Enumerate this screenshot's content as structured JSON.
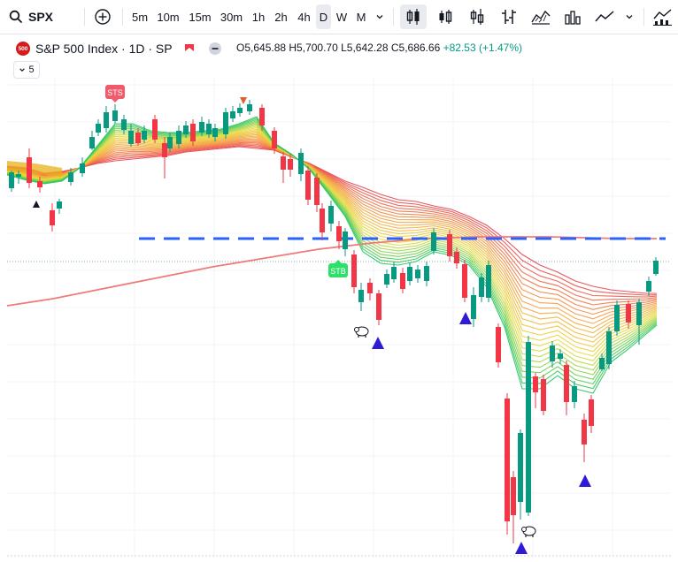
{
  "toolbar": {
    "symbol": "SPX",
    "intervals": [
      "5m",
      "10m",
      "15m",
      "30m",
      "1h",
      "2h",
      "4h",
      "D",
      "W",
      "M"
    ],
    "active_interval": "D"
  },
  "legend": {
    "logo_text": "500",
    "title": "S&P 500 Index · 1D · SP",
    "open": "O5,645.88",
    "high": "H5,700.70",
    "low": "L5,642.28",
    "close": "C5,686.66",
    "change": "+82.53 (+1.47%)"
  },
  "indicators": {
    "count": "5"
  },
  "colors": {
    "up": "#089981",
    "down": "#f23645",
    "ribbon_fast": "#22c55e",
    "ribbon_slow": "#e8434d",
    "ma_line": "#f07a7a",
    "dashed_level": "#2962ff",
    "arrow": "#2f1bd6"
  },
  "annotations": {
    "sts_top": "STS",
    "sts_bottom": "STB"
  }
}
